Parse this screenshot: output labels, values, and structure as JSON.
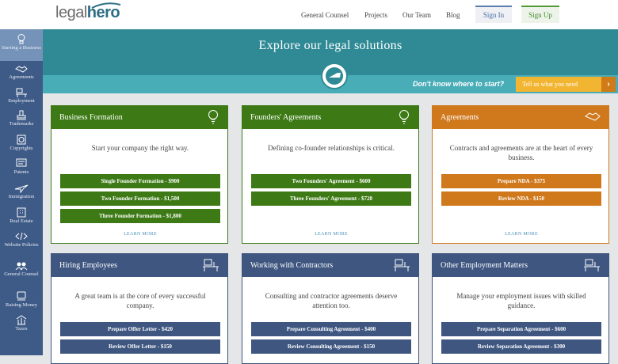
{
  "brand": {
    "logo_part1": "legal",
    "logo_part2": "hero"
  },
  "nav": {
    "links": [
      "General Counsel",
      "Projects",
      "Our Team",
      "Blog"
    ],
    "sign_in": "Sign In",
    "sign_up": "Sign Up"
  },
  "sidebar": {
    "items": [
      {
        "label": "Starting a Business",
        "icon": "lightbulb-icon"
      },
      {
        "label": "Agreements",
        "icon": "handshake-icon"
      },
      {
        "label": "Employment",
        "icon": "desk-icon"
      },
      {
        "label": "Trademarks",
        "icon": "stamp-icon"
      },
      {
        "label": "Copyrights",
        "icon": "copyright-icon"
      },
      {
        "label": "Patents",
        "icon": "patent-icon"
      },
      {
        "label": "Immigration",
        "icon": "plane-icon"
      },
      {
        "label": "Real Estate",
        "icon": "building-icon"
      },
      {
        "label": "Website Policies",
        "icon": "code-icon"
      },
      {
        "label": "General Counsel",
        "icon": "people-icon"
      },
      {
        "label": "Raising Money",
        "icon": "money-icon"
      },
      {
        "label": "Taxes",
        "icon": "taxes-icon"
      }
    ]
  },
  "hero": {
    "title": "Explore our legal solutions",
    "question": "Don't know where to start?",
    "cta": "Tell us what you need",
    "cta_arrow": "›"
  },
  "cards": [
    {
      "title": "Business Formation",
      "icon": "lightbulb-icon",
      "desc": "Start your company the right way.",
      "buttons": [
        "Single Founder Formation - $900",
        "Two Founder Formation - $1,500",
        "Three Founder Formation - $1,800"
      ],
      "learn": "LEARN MORE"
    },
    {
      "title": "Founders' Agreements",
      "icon": "lightbulb-icon",
      "desc": "Defining co-founder relationships is critical.",
      "buttons": [
        "Two Founders' Agreement - $600",
        "Three Founders' Agreement - $720"
      ],
      "learn": "LEARN MORE"
    },
    {
      "title": "Agreements",
      "icon": "handshake-icon",
      "desc": "Contracts and agreements are at the heart of every business.",
      "buttons": [
        "Prepare NDA - $375",
        "Review NDA - $150"
      ],
      "learn": "LEARN MORE"
    },
    {
      "title": "Hiring Employees",
      "icon": "desk-icon",
      "desc": "A great team is at the core of every successful company.",
      "buttons": [
        "Prepare Offer Letter - $420",
        "Review Offer Letter - $150"
      ]
    },
    {
      "title": "Working with Contractors",
      "icon": "desk-icon",
      "desc": "Consulting and contractor agreements deserve attention too.",
      "buttons": [
        "Prepare Consulting Agreement - $400",
        "Review Consulting Agreement - $150"
      ]
    },
    {
      "title": "Other Employment Matters",
      "icon": "desk-icon",
      "desc": "Manage your employment issues with skilled guidance.",
      "buttons": [
        "Prepare Separation Agreement - $600",
        "Review Separation Agreement - $300"
      ]
    }
  ],
  "colors": {
    "green": "#3d7a16",
    "orange": "#d0781c",
    "navy": "#3e5680",
    "teal": "#2f8a95",
    "sidebar": "#3e5a86"
  }
}
